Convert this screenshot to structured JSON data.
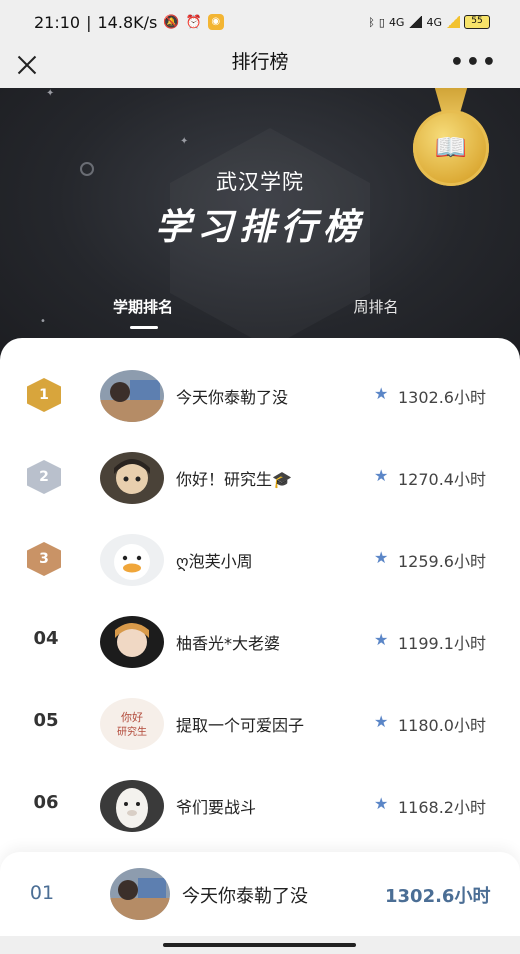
{
  "status_bar": {
    "time": "21:10",
    "network_speed": "14.8K/s",
    "icons": [
      "mute-icon",
      "alarm-icon",
      "app-badge-icon",
      "bluetooth-icon",
      "vibrate-icon",
      "signal-4g-icon",
      "signal-4g-icon",
      "battery-icon"
    ],
    "signal_label_1": "4G",
    "signal_label_2": "4G",
    "battery": "55"
  },
  "nav": {
    "title": "排行榜",
    "close_icon": "close-icon",
    "more_label": "•••"
  },
  "hero": {
    "school": "武汉学院",
    "title": "学习排行榜",
    "tabs": [
      {
        "label": "学期排名",
        "active": true
      },
      {
        "label": "周排名",
        "active": false
      }
    ]
  },
  "colors": {
    "gold": "#d8a53c",
    "silver": "#b9c0cc",
    "bronze": "#c99366",
    "accent_blue": "#4b6e95",
    "hero_dark": "#25272c"
  },
  "rankings": [
    {
      "rank": "1",
      "name": "今天你泰勒了没",
      "hours": "1302.6小时",
      "medal": "gold"
    },
    {
      "rank": "2",
      "name": "你好！研究生🎓",
      "hours": "1270.4小时",
      "medal": "silver"
    },
    {
      "rank": "3",
      "name": "ღ泡芙小周",
      "hours": "1259.6小时",
      "medal": "bronze"
    },
    {
      "rank": "04",
      "name": "柚香光*大老婆",
      "hours": "1199.1小时"
    },
    {
      "rank": "05",
      "name": "提取一个可爱因子",
      "hours": "1180.0小时"
    },
    {
      "rank": "06",
      "name": "爷们要战斗",
      "hours": "1168.2小时"
    }
  ],
  "avatar_texts": {
    "row5": "你好研究生"
  },
  "my_rank": {
    "rank": "01",
    "name": "今天你泰勒了没",
    "hours": "1302.6小时"
  }
}
